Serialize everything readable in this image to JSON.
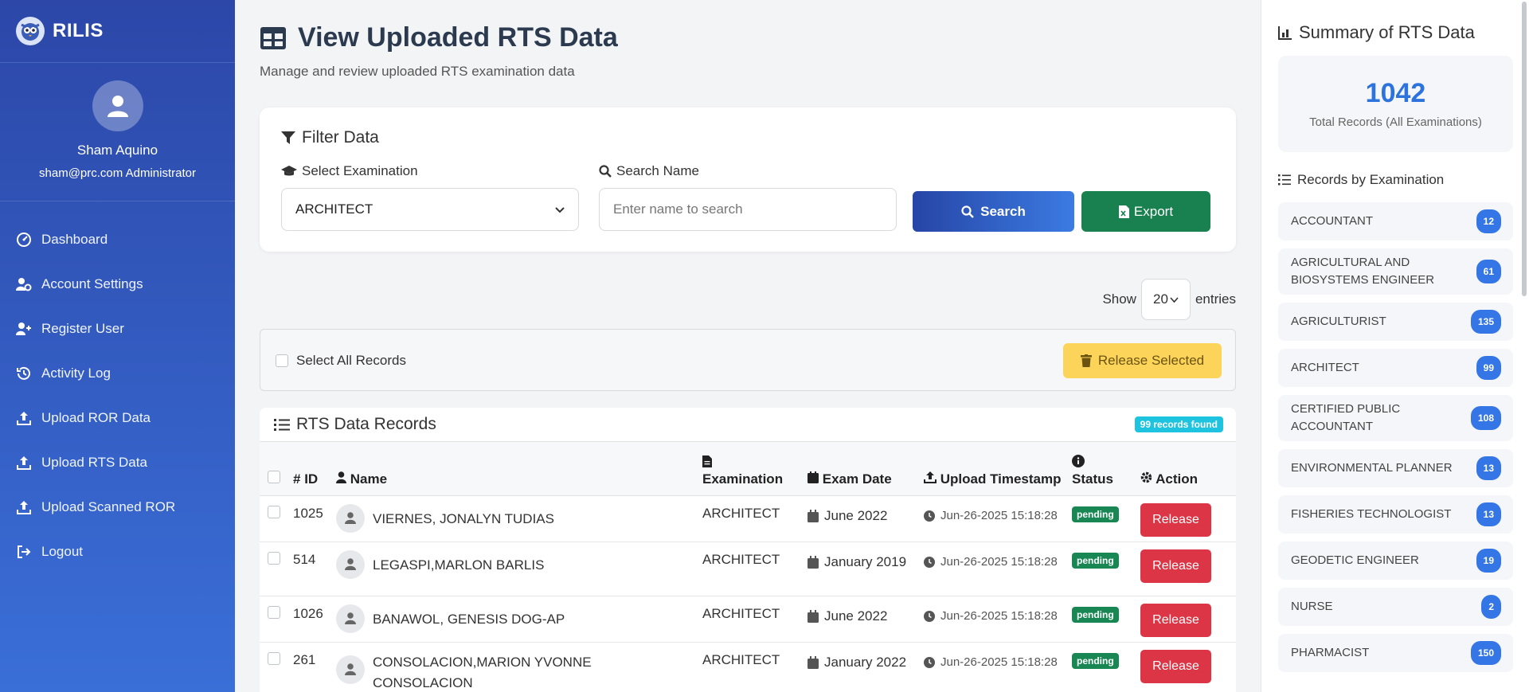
{
  "brand": {
    "name": "RILIS"
  },
  "profile": {
    "name": "Sham Aquino",
    "email_role": "sham@prc.com Administrator"
  },
  "nav": [
    {
      "label": "Dashboard",
      "icon": "dashboard-icon"
    },
    {
      "label": "Account Settings",
      "icon": "user-gear-icon"
    },
    {
      "label": "Register User",
      "icon": "user-plus-icon"
    },
    {
      "label": "Activity Log",
      "icon": "history-icon"
    },
    {
      "label": "Upload ROR Data",
      "icon": "upload-icon"
    },
    {
      "label": "Upload RTS Data",
      "icon": "upload-icon"
    },
    {
      "label": "Upload Scanned ROR",
      "icon": "upload-icon"
    },
    {
      "label": "Logout",
      "icon": "logout-icon"
    }
  ],
  "page": {
    "title": "View Uploaded RTS Data",
    "subtitle": "Manage and review uploaded RTS examination data"
  },
  "filter": {
    "title": "Filter Data",
    "exam_label": "Select Examination",
    "exam_value": "ARCHITECT",
    "search_label": "Search Name",
    "search_placeholder": "Enter name to search",
    "search_button": "Search",
    "export_button": "Export"
  },
  "entries": {
    "show": "Show",
    "value": "20",
    "suffix": "entries"
  },
  "bulk": {
    "select_all": "Select All Records",
    "release_selected": "Release Selected"
  },
  "table": {
    "title": "RTS Data Records",
    "found": "99 records found",
    "headers": {
      "id": "ID",
      "name": "Name",
      "exam": "Examination",
      "date": "Exam Date",
      "upload": "Upload Timestamp",
      "status": "Status",
      "action": "Action"
    },
    "rows": [
      {
        "id": "1025",
        "name": "VIERNES, JONALYN TUDIAS",
        "exam": "ARCHITECT",
        "date": "June 2022",
        "upload": "Jun-26-2025 15:18:28",
        "status": "pending",
        "action": "Release"
      },
      {
        "id": "514",
        "name": "LEGASPI,MARLON BARLIS",
        "exam": "ARCHITECT",
        "date": "January 2019",
        "upload": "Jun-26-2025 15:18:28",
        "status": "pending",
        "action": "Release"
      },
      {
        "id": "1026",
        "name": "BANAWOL, GENESIS DOG-AP",
        "exam": "ARCHITECT",
        "date": "June 2022",
        "upload": "Jun-26-2025 15:18:28",
        "status": "pending",
        "action": "Release"
      },
      {
        "id": "261",
        "name": "CONSOLACION,MARION YVONNE CONSOLACION",
        "exam": "ARCHITECT",
        "date": "January 2022",
        "upload": "Jun-26-2025 15:18:28",
        "status": "pending",
        "action": "Release"
      }
    ]
  },
  "summary": {
    "title": "Summary of RTS Data",
    "total": "1042",
    "total_label": "Total Records (All Examinations)",
    "by_exam_title": "Records by Examination",
    "exams": [
      {
        "name": "ACCOUNTANT",
        "count": "12"
      },
      {
        "name": "AGRICULTURAL AND BIOSYSTEMS ENGINEER",
        "count": "61"
      },
      {
        "name": "AGRICULTURIST",
        "count": "135"
      },
      {
        "name": "ARCHITECT",
        "count": "99"
      },
      {
        "name": "CERTIFIED PUBLIC ACCOUNTANT",
        "count": "108"
      },
      {
        "name": "ENVIRONMENTAL PLANNER",
        "count": "13"
      },
      {
        "name": "FISHERIES TECHNOLOGIST",
        "count": "13"
      },
      {
        "name": "GEODETIC ENGINEER",
        "count": "19"
      },
      {
        "name": "NURSE",
        "count": "2"
      },
      {
        "name": "PHARMACIST",
        "count": "150"
      }
    ]
  },
  "colors": {
    "sidebar_top": "#2c47a8",
    "sidebar_bottom": "#3a6fd8",
    "accent": "#2d73de",
    "export": "#19804f",
    "release": "#dc3545",
    "pending": "#198754",
    "warning": "#fcd45a"
  }
}
